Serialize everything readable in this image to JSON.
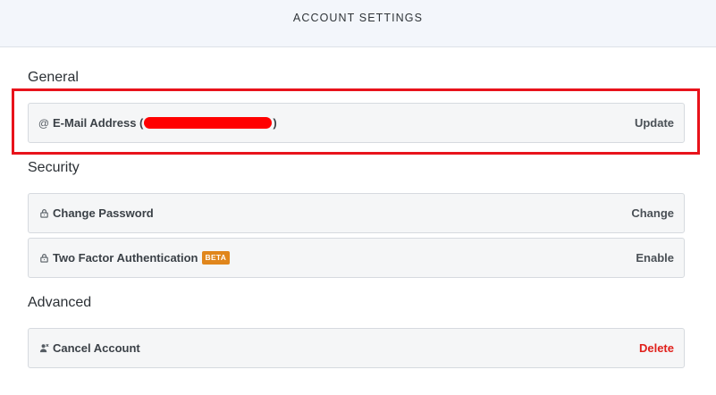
{
  "header": {
    "title": "ACCOUNT SETTINGS"
  },
  "sections": {
    "general": {
      "heading": "General",
      "email_row": {
        "label": "E-Mail Address (",
        "label_close": ")",
        "icon": "at-icon",
        "action": "Update"
      }
    },
    "security": {
      "heading": "Security",
      "password_row": {
        "label": "Change Password",
        "icon": "lock-icon",
        "action": "Change"
      },
      "twofa_row": {
        "label": "Two Factor Authentication",
        "badge": "BETA",
        "icon": "lock-icon",
        "action": "Enable"
      }
    },
    "advanced": {
      "heading": "Advanced",
      "cancel_row": {
        "label": "Cancel Account",
        "icon": "user-remove-icon",
        "action": "Delete"
      }
    }
  },
  "colors": {
    "danger": "#e0201b",
    "beta": "#e0861c",
    "highlight": "#e8131b",
    "redaction": "#ff0000"
  }
}
